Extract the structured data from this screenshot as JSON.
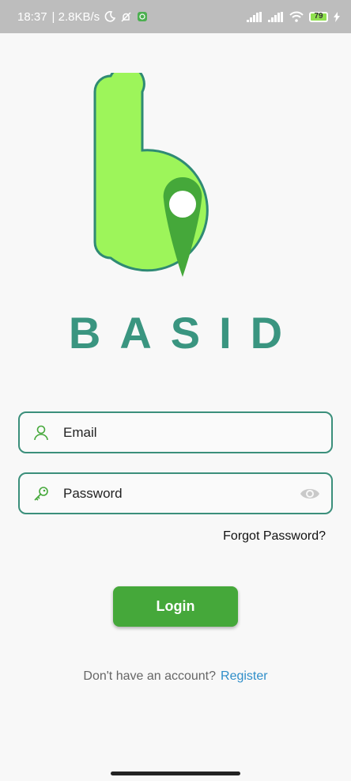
{
  "status_bar": {
    "time": "18:37",
    "speed": "| 2.8KB/s",
    "battery": "79"
  },
  "brand": {
    "name": "BASID"
  },
  "colors": {
    "accent_green": "#45a83a",
    "brand_teal": "#3a9580",
    "logo_fill": "#9df55a",
    "link_blue": "#2f8ec9"
  },
  "form": {
    "email": {
      "placeholder": "Email",
      "icon": "person-icon"
    },
    "password": {
      "placeholder": "Password",
      "icon": "key-icon",
      "toggle_icon": "eye-icon"
    },
    "forgot_label": "Forgot Password?",
    "login_label": "Login"
  },
  "footer": {
    "question": "Don't have an account?",
    "register_label": "Register"
  }
}
